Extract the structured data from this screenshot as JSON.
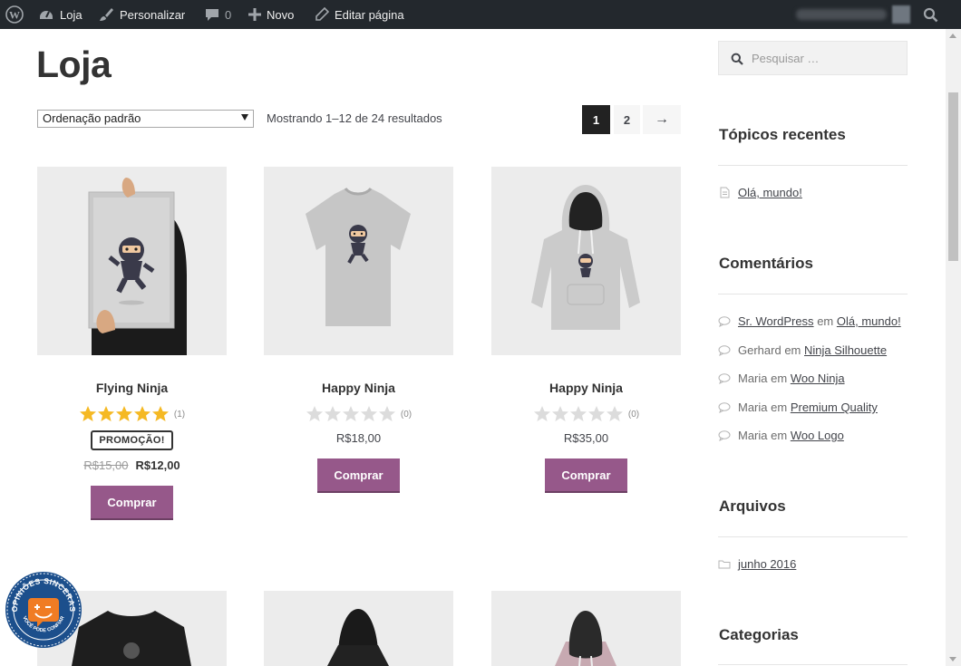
{
  "adminbar": {
    "items": [
      {
        "label": "Loja"
      },
      {
        "label": "Personalizar"
      },
      {
        "label": "0"
      },
      {
        "label": "Novo"
      },
      {
        "label": "Editar página"
      }
    ]
  },
  "main": {
    "title": "Loja",
    "orderby": "Ordenação padrão",
    "result_count": "Mostrando 1–12 de 24 resultados",
    "pagination": [
      "1",
      "2",
      "→"
    ]
  },
  "products": [
    {
      "name": "Flying Ninja",
      "rating": 5,
      "rating_count": "(1)",
      "sale_label": "PROMOÇÃO!",
      "old_price": "R$15,00",
      "price": "R$12,00",
      "button": "Comprar"
    },
    {
      "name": "Happy Ninja",
      "rating": 0,
      "rating_count": "(0)",
      "price": "R$18,00",
      "button": "Comprar"
    },
    {
      "name": "Happy Ninja",
      "rating": 0,
      "rating_count": "(0)",
      "price": "R$35,00",
      "button": "Comprar"
    }
  ],
  "sidebar": {
    "search_placeholder": "Pesquisar …",
    "recent_posts": {
      "title": "Tópicos recentes",
      "items": [
        "Olá, mundo!"
      ]
    },
    "comments": {
      "title": "Comentários",
      "items": [
        {
          "author": "Sr. WordPress",
          "sep": "em",
          "post": "Olá, mundo!"
        },
        {
          "author": "Gerhard",
          "sep": "em",
          "post": "Ninja Silhouette"
        },
        {
          "author": "Maria",
          "sep": "em",
          "post": "Woo Ninja"
        },
        {
          "author": "Maria",
          "sep": "em",
          "post": "Premium Quality"
        },
        {
          "author": "Maria",
          "sep": "em",
          "post": "Woo Logo"
        }
      ]
    },
    "archives": {
      "title": "Arquivos",
      "items": [
        "junho 2016"
      ]
    },
    "categories": {
      "title": "Categorias"
    }
  },
  "badge": {
    "text": "OPINIÕES SINCERAS",
    "subtext": "VOCÊ PODE CONFIAR"
  },
  "colors": {
    "accent": "#96588a",
    "adminbar": "#23282d",
    "star": "#f5b924",
    "star_empty": "#dcdcdc"
  }
}
